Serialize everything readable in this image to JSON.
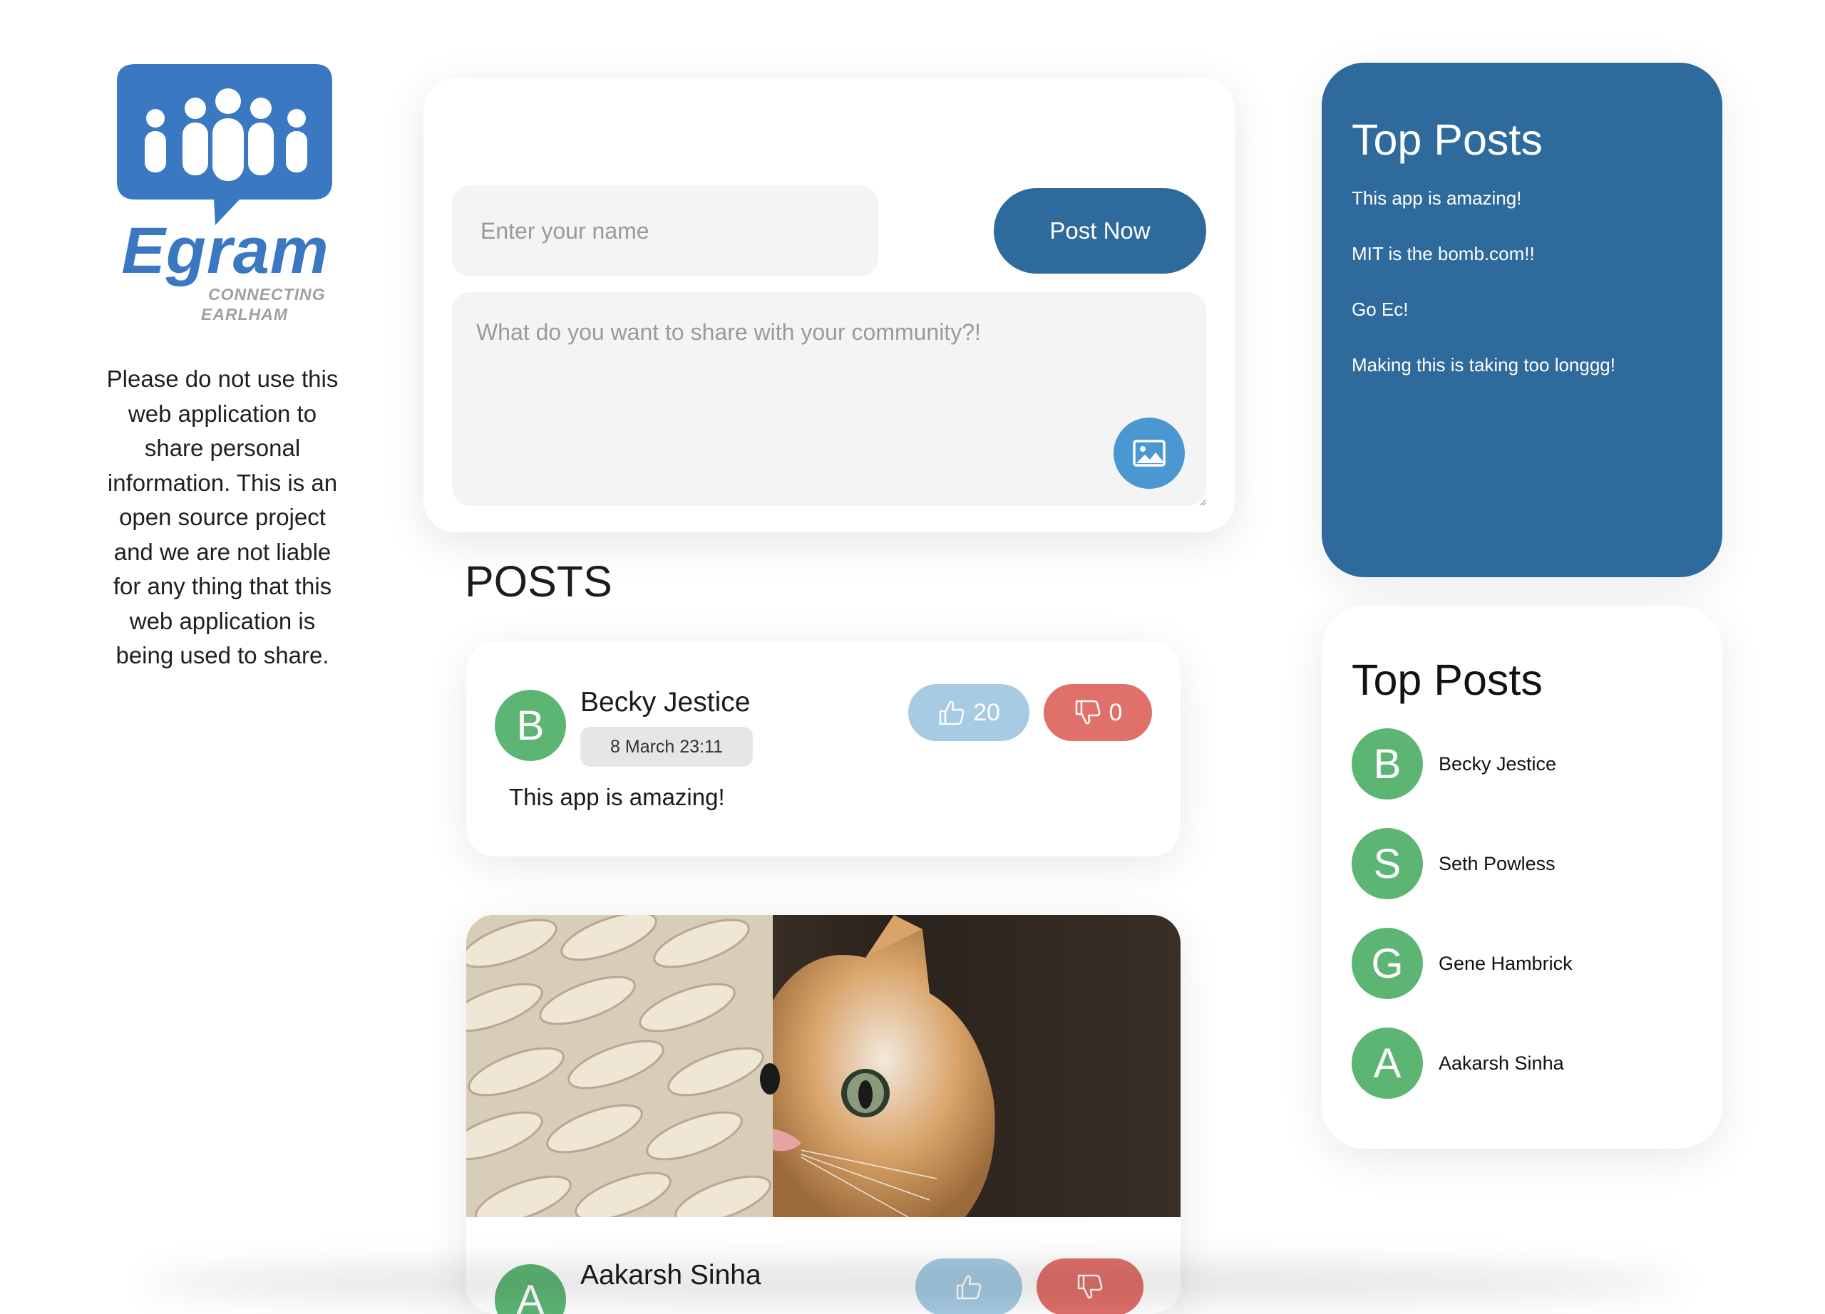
{
  "brand": {
    "name": "Egram",
    "tagline_line1": "CONNECTING",
    "tagline_line2": "EARLHAM"
  },
  "disclaimer": "Please do not use this web application to share personal information. This is an open source project and we are not liable for any thing that this web application is being used to share.",
  "composer": {
    "name_placeholder": "Enter your name",
    "name_value": "",
    "message_placeholder": "What do you want to share with your community?!",
    "message_value": "",
    "post_button": "Post Now",
    "image_icon": "image-icon"
  },
  "feed": {
    "heading": "POSTS",
    "posts": [
      {
        "initial": "B",
        "author": "Becky Jestice",
        "timestamp": "8 March 23:11",
        "content": "This app is amazing!",
        "likes": "20",
        "dislikes": "0"
      },
      {
        "initial": "A",
        "author": "Aakarsh Sinha",
        "image": "kitten peeking from wicker basket"
      }
    ]
  },
  "top_posts": {
    "title": "Top Posts",
    "items": [
      "This app is amazing!",
      "MIT is the bomb.com!!",
      "Go Ec!",
      "Making this is taking too longgg!"
    ]
  },
  "top_users": {
    "title": "Top Posts",
    "users": [
      {
        "initial": "B",
        "name": "Becky Jestice"
      },
      {
        "initial": "S",
        "name": "Seth Powless"
      },
      {
        "initial": "G",
        "name": "Gene Hambrick"
      },
      {
        "initial": "A",
        "name": "Aakarsh Sinha"
      }
    ]
  },
  "colors": {
    "primary": "#2e6a9b",
    "avatar": "#5db574",
    "like": "#a6cbe3",
    "dislike": "#e0706a",
    "upload": "#4a97d2"
  }
}
